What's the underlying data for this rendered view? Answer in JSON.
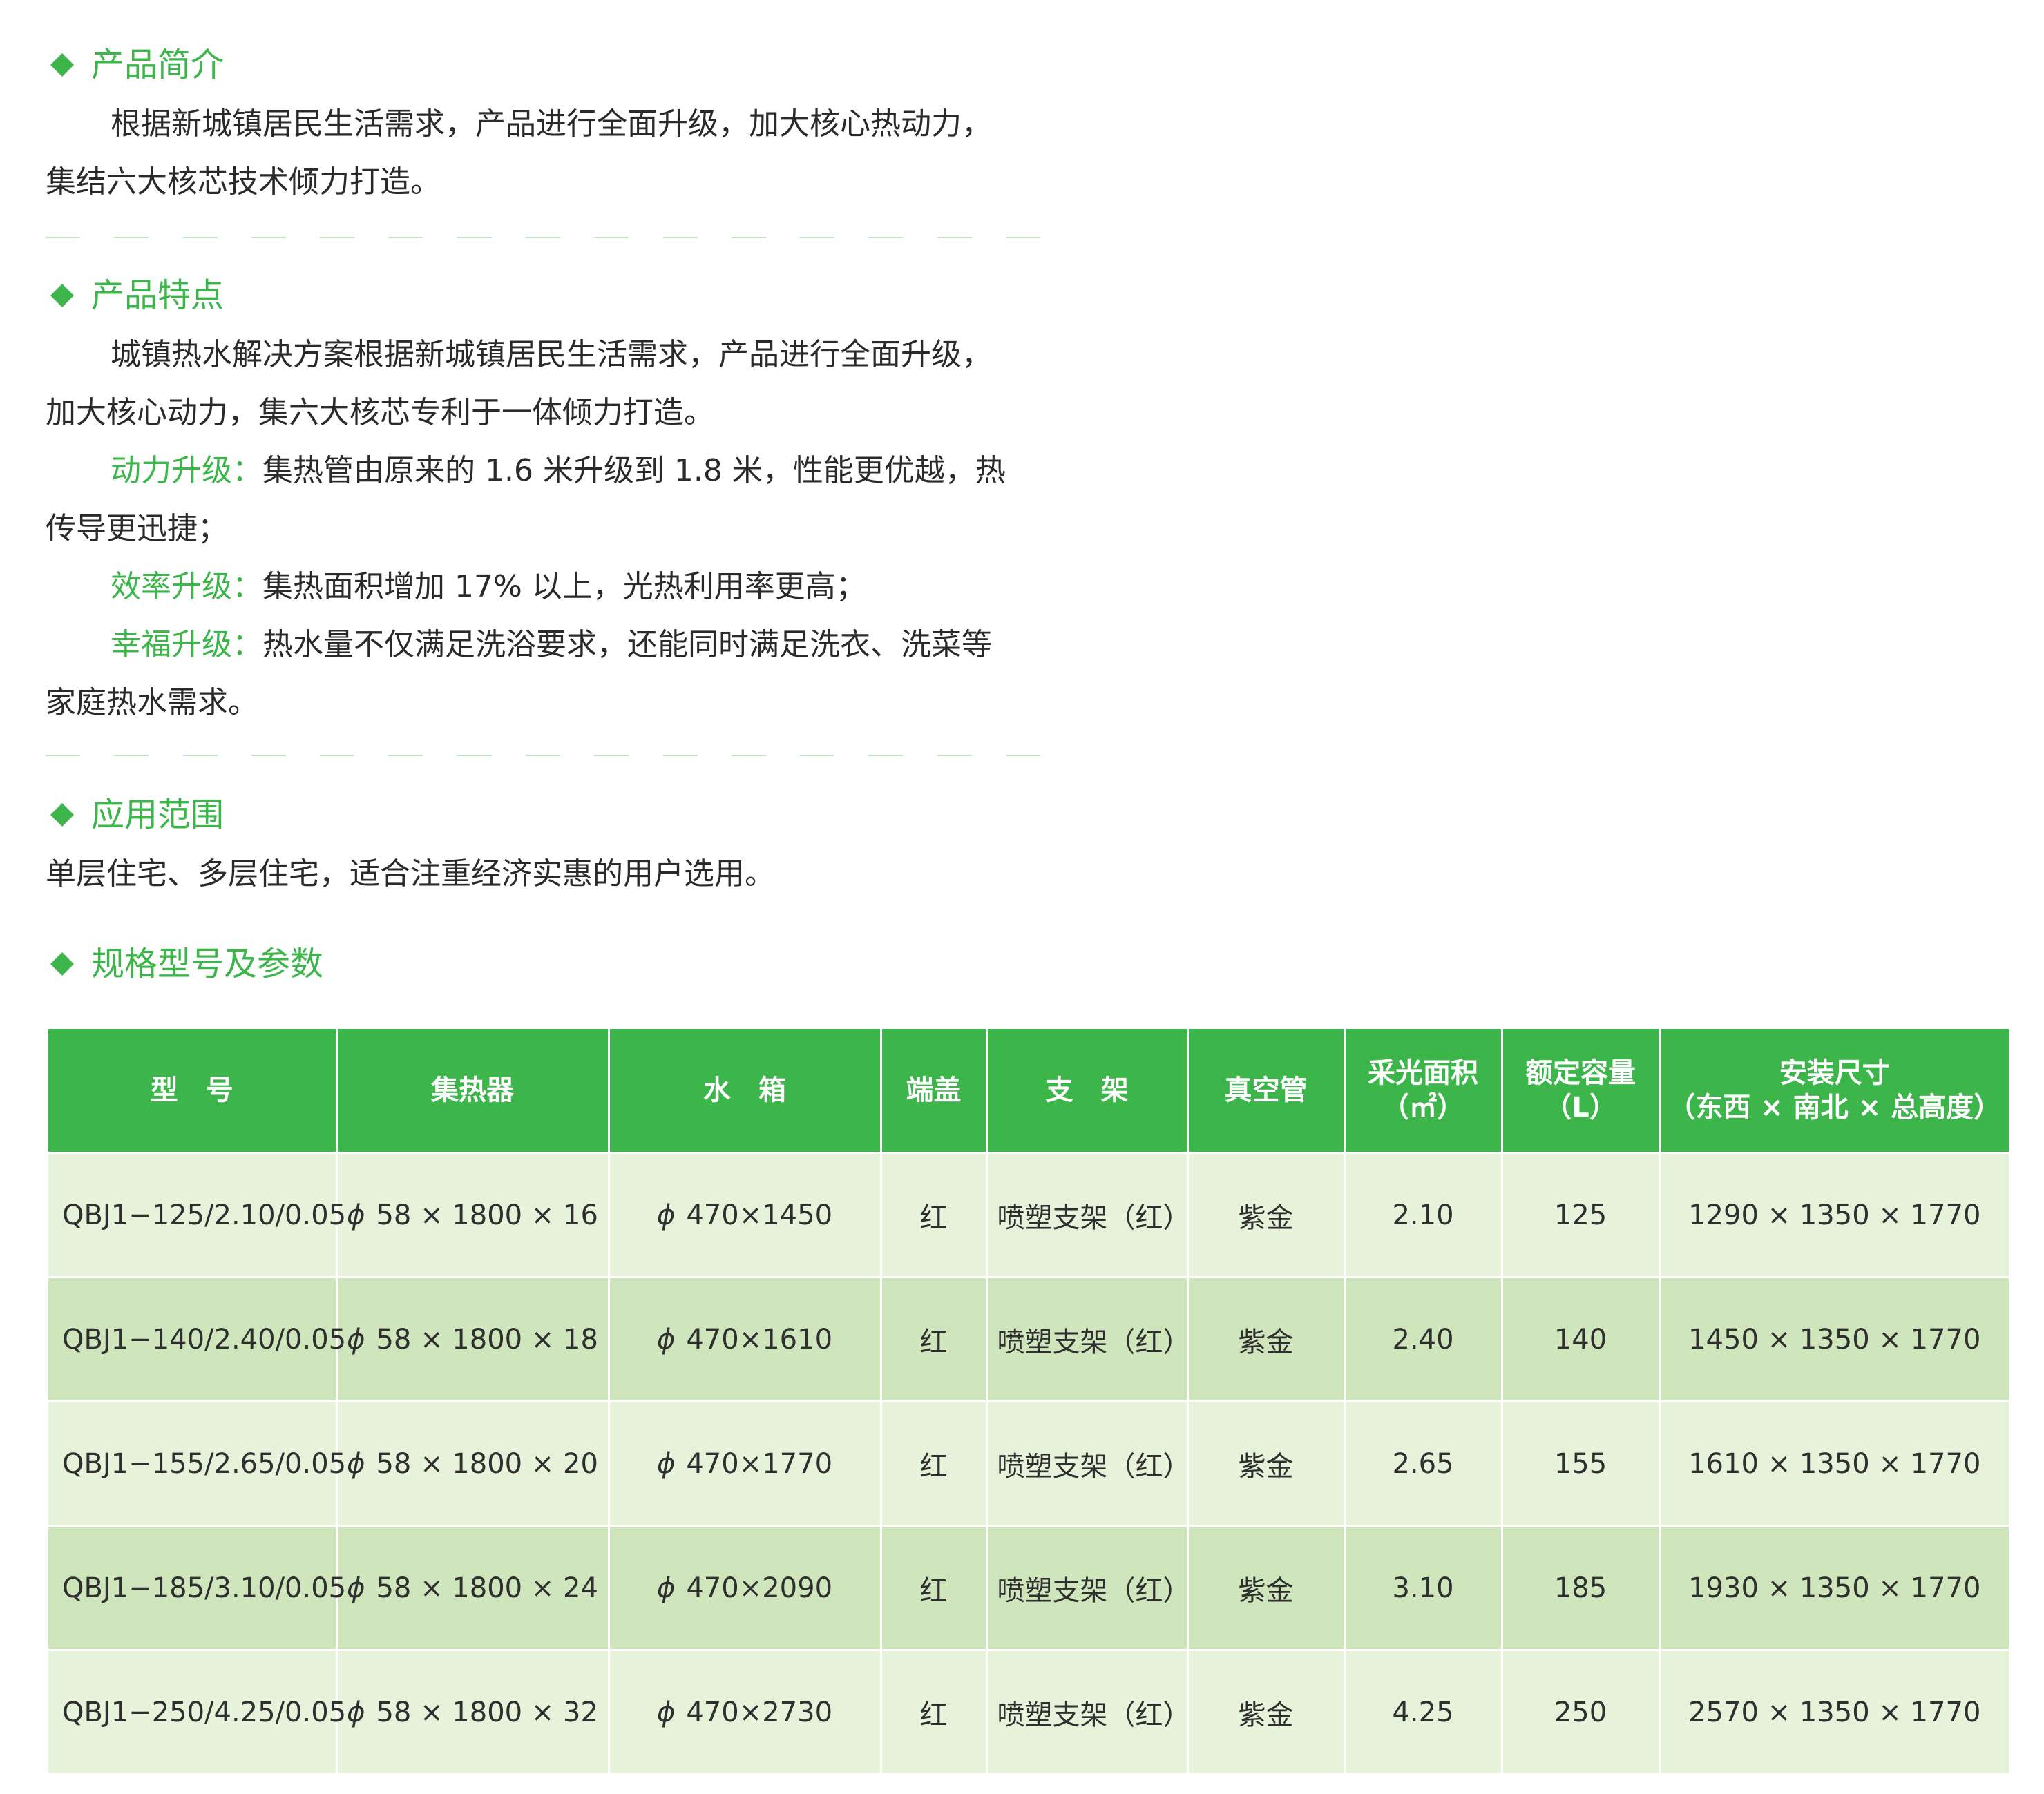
{
  "intro": {
    "title": "产品简介",
    "line1": "根据新城镇居民生活需求，产品进行全面升级，加大核心热动力，",
    "line2": "集结六大核芯技术倾力打造。"
  },
  "features": {
    "title": "产品特点",
    "line1": "城镇热水解决方案根据新城镇居民生活需求，产品进行全面升级，",
    "line2": "加大核心动力，集六大核芯专利于一体倾力打造。",
    "power_label": "动力升级：",
    "power_text": "集热管由原来的 1.6 米升级到 1.8 米，性能更优越，热",
    "power_text2": "传导更迅捷；",
    "efficiency_label": "效率升级：",
    "efficiency_text": "集热面积增加 17% 以上，光热利用率更高；",
    "happiness_label": "幸福升级：",
    "happiness_text": "热水量不仅满足洗浴要求，还能同时满足洗衣、洗菜等",
    "happiness_text2": "家庭热水需求。"
  },
  "scope": {
    "title": "应用范围",
    "text": "单层住宅、多层住宅，适合注重经济实惠的用户选用。"
  },
  "specs": {
    "title": "规格型号及参数",
    "headers": {
      "model": "型　号",
      "collector": "集热器",
      "tank": "水　箱",
      "cap": "端盖",
      "stand": "支　架",
      "tube": "真空管",
      "area": "采光面积",
      "area_unit": "（㎡）",
      "volume": "额定容量",
      "volume_unit": "（L）",
      "size": "安装尺寸",
      "size_sub": "（东西 × 南北 × 总高度）"
    },
    "phi_symbol": "ϕ",
    "rows": [
      {
        "model": "QBJ1−125/2.10/0.05",
        "collector": "58 × 1800 × 16",
        "tank": "470×1450",
        "cap": "红",
        "stand": "喷塑支架（红）",
        "tube": "紫金",
        "area": "2.10",
        "volume": "125",
        "size": "1290 × 1350 × 1770"
      },
      {
        "model": "QBJ1−140/2.40/0.05",
        "collector": "58 × 1800 × 18",
        "tank": "470×1610",
        "cap": "红",
        "stand": "喷塑支架（红）",
        "tube": "紫金",
        "area": "2.40",
        "volume": "140",
        "size": "1450 × 1350 × 1770"
      },
      {
        "model": "QBJ1−155/2.65/0.05",
        "collector": "58 × 1800 × 20",
        "tank": "470×1770",
        "cap": "红",
        "stand": "喷塑支架（红）",
        "tube": "紫金",
        "area": "2.65",
        "volume": "155",
        "size": "1610 × 1350 × 1770"
      },
      {
        "model": "QBJ1−185/3.10/0.05",
        "collector": "58 × 1800 × 24",
        "tank": "470×2090",
        "cap": "红",
        "stand": "喷塑支架（红）",
        "tube": "紫金",
        "area": "3.10",
        "volume": "185",
        "size": "1930 × 1350 × 1770"
      },
      {
        "model": "QBJ1−250/4.25/0.05",
        "collector": "58 × 1800 × 32",
        "tank": "470×2730",
        "cap": "红",
        "stand": "喷塑支架（红）",
        "tube": "紫金",
        "area": "4.25",
        "volume": "250",
        "size": "2570 × 1350 × 1770"
      }
    ]
  },
  "colors": {
    "accent": "#3cb54a",
    "row_light": "#e6f2da",
    "row_dark": "#cfe6bd"
  }
}
